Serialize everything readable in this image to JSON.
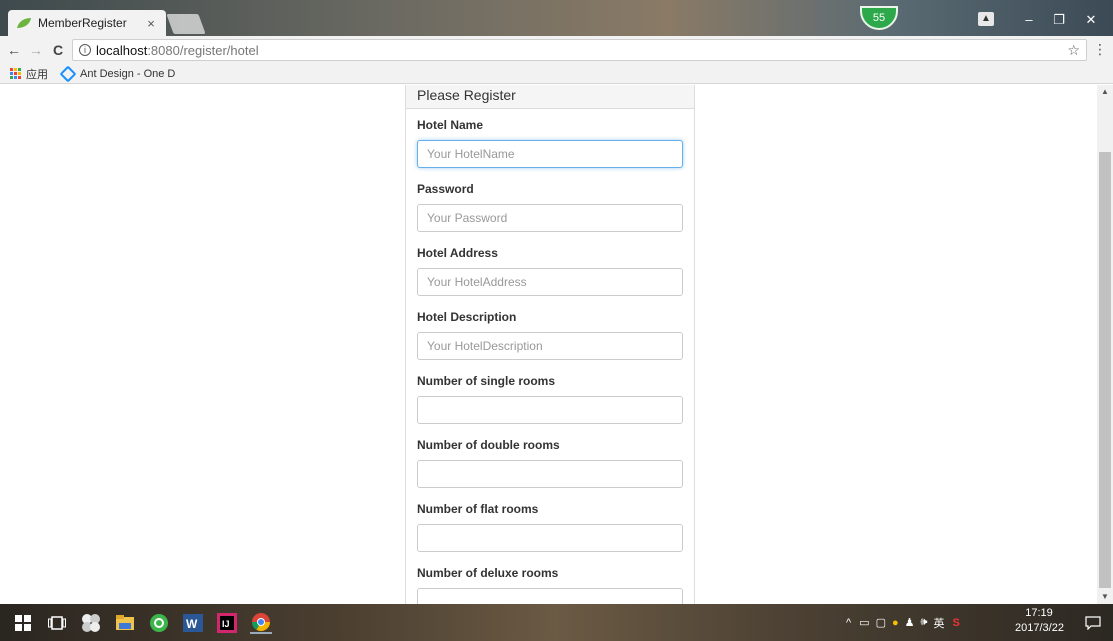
{
  "browser": {
    "tab_title": "MemberRegister",
    "tab_close": "×",
    "badge": "55",
    "win_minimize": "–",
    "win_restore": "❐",
    "win_close": "✕",
    "url_host": "localhost",
    "url_path": ":8080/register/hotel",
    "url_info": "i",
    "back": "←",
    "forward": "→",
    "reload": "C",
    "star": "☆",
    "menu": "⋮"
  },
  "bookmarks": {
    "apps_label": "应用",
    "ant_label": "Ant Design - One D"
  },
  "form": {
    "heading": "Please Register",
    "fields": [
      {
        "label": "Hotel Name",
        "placeholder": "Your HotelName",
        "value": ""
      },
      {
        "label": "Password",
        "placeholder": "Your Password",
        "value": ""
      },
      {
        "label": "Hotel Address",
        "placeholder": "Your HotelAddress",
        "value": ""
      },
      {
        "label": "Hotel Description",
        "placeholder": "Your HotelDescription",
        "value": ""
      },
      {
        "label": "Number of single rooms",
        "placeholder": "",
        "value": ""
      },
      {
        "label": "Number of double rooms",
        "placeholder": "",
        "value": ""
      },
      {
        "label": "Number of flat rooms",
        "placeholder": "",
        "value": ""
      },
      {
        "label": "Number of deluxe rooms",
        "placeholder": "",
        "value": ""
      }
    ]
  },
  "taskbar": {
    "time": "17:19",
    "date": "2017/3/22",
    "ime": "英",
    "tray_up": "^",
    "volume": "🕪"
  },
  "colors": {
    "focus_border": "#66afe9",
    "apps_dots": [
      "#ea4335",
      "#fbbc05",
      "#34a853",
      "#4285f4",
      "#ea4335",
      "#fbbc05",
      "#34a853",
      "#4285f4",
      "#ea4335"
    ]
  }
}
